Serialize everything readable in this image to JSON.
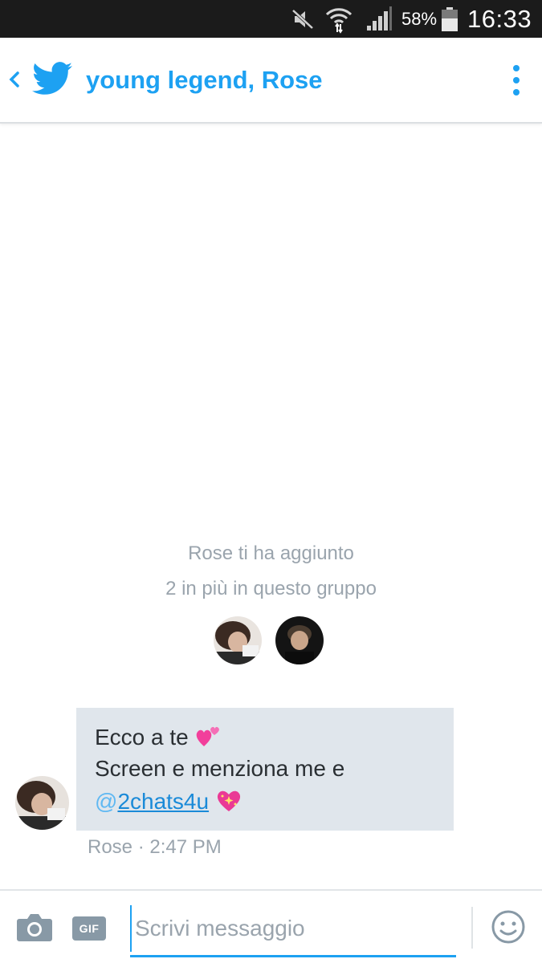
{
  "status_bar": {
    "battery_percent": "58%",
    "time": "16:33",
    "icons": [
      "mute-icon",
      "wifi-icon",
      "signal-icon",
      "battery-icon"
    ]
  },
  "header": {
    "title": "young legend, Rose",
    "icons": [
      "back-chevron-icon",
      "twitter-bird-icon",
      "overflow-menu-icon"
    ],
    "accent_color": "#1da1f2"
  },
  "conversation": {
    "notice_added": "Rose ti ha aggiunto",
    "notice_members": "2 in più in questo gruppo",
    "message": {
      "line1": "Ecco a te",
      "line1_emoji": "two-hearts-emoji",
      "line2": "Screen e menziona me e",
      "mention_at": "@",
      "mention_name": "2chats4u",
      "line3_emoji": "sparkling-heart-emoji",
      "sender": "Rose",
      "separator": " · ",
      "time": "2:47 PM"
    }
  },
  "compose": {
    "gif_label": "GIF",
    "placeholder": "Scrivi messaggio",
    "icons": [
      "camera-icon",
      "smiley-icon"
    ]
  }
}
